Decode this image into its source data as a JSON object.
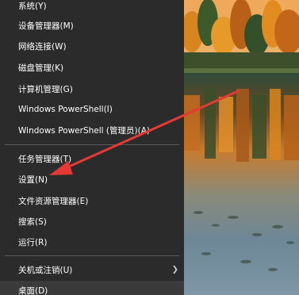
{
  "menu": {
    "items": [
      {
        "label": "系统(Y)"
      },
      {
        "label": "设备管理器(M)"
      },
      {
        "label": "网络连接(W)"
      },
      {
        "label": "磁盘管理(K)"
      },
      {
        "label": "计算机管理(G)"
      },
      {
        "label": "Windows PowerShell(I)"
      },
      {
        "label": "Windows PowerShell (管理员)(A)"
      },
      {
        "label": "任务管理器(T)"
      },
      {
        "label": "设置(N)"
      },
      {
        "label": "文件资源管理器(E)"
      },
      {
        "label": "搜索(S)"
      },
      {
        "label": "运行(R)"
      },
      {
        "label": "关机或注销(U)"
      },
      {
        "label": "桌面(D)"
      }
    ]
  },
  "annotation": {
    "color": "#e53935",
    "points_to": "设置(N)"
  },
  "colors": {
    "menu_background": "#2b2b2b",
    "menu_text": "#ffffff",
    "separator": "#5a5a5a"
  }
}
